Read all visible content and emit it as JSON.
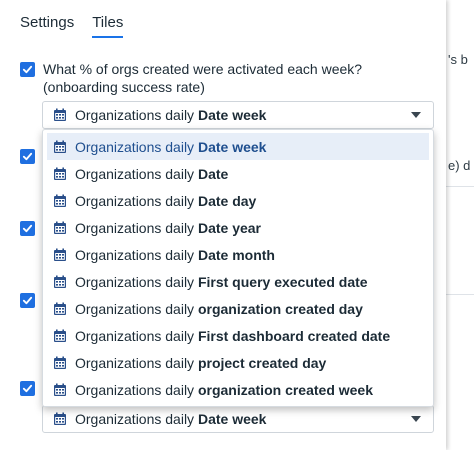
{
  "tabs": [
    {
      "label": "Settings"
    },
    {
      "label": "Tiles"
    }
  ],
  "background": {
    "text_1": "'s b",
    "text_2": "e) d"
  },
  "tile_1": {
    "question": "What % of orgs created were activated each week? (onboarding success rate)",
    "select": {
      "prefix": "Organizations daily",
      "value": "Date week"
    }
  },
  "tile_last": {
    "select": {
      "prefix": "Organizations daily",
      "value": "Date week"
    }
  },
  "dropdown": {
    "options": [
      {
        "prefix": "Organizations daily",
        "field": "Date week",
        "selected": true
      },
      {
        "prefix": "Organizations daily",
        "field": "Date",
        "selected": false
      },
      {
        "prefix": "Organizations daily",
        "field": "Date day",
        "selected": false
      },
      {
        "prefix": "Organizations daily",
        "field": "Date year",
        "selected": false
      },
      {
        "prefix": "Organizations daily",
        "field": "Date month",
        "selected": false
      },
      {
        "prefix": "Organizations daily",
        "field": "First query executed date",
        "selected": false
      },
      {
        "prefix": "Organizations daily",
        "field": "organization created day",
        "selected": false
      },
      {
        "prefix": "Organizations daily",
        "field": "First dashboard created date",
        "selected": false
      },
      {
        "prefix": "Organizations daily",
        "field": "project created day",
        "selected": false
      },
      {
        "prefix": "Organizations daily",
        "field": "organization created week",
        "selected": false
      }
    ]
  },
  "colors": {
    "accent": "#1f6fe0",
    "selected_bg": "#e7eef8",
    "icon": "#2a4f8a"
  },
  "icons": {
    "calendar": "calendar-icon",
    "check": "checkmark-icon",
    "caret": "caret-down-icon"
  }
}
